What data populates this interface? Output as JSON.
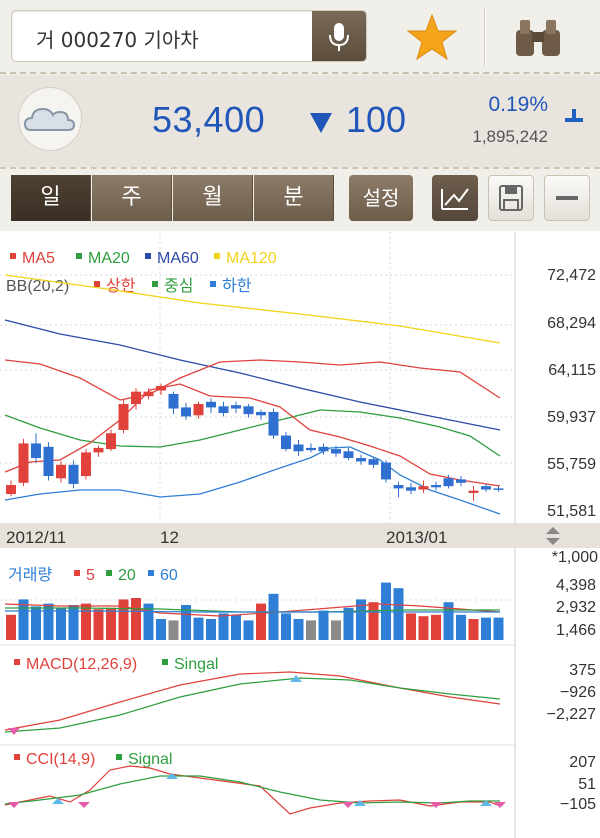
{
  "search": {
    "text": "거 000270 기아차"
  },
  "quote": {
    "price": "53,400",
    "change": "100",
    "change_pct": "0.19%",
    "volume": "1,895,242"
  },
  "periods": [
    {
      "label": "일",
      "active": true
    },
    {
      "label": "주"
    },
    {
      "label": "월"
    },
    {
      "label": "분"
    }
  ],
  "settings_label": "설정",
  "legend": {
    "ma": [
      {
        "label": "MA5",
        "color": "#e0413b"
      },
      {
        "label": "MA20",
        "color": "#2e9e3e"
      },
      {
        "label": "MA60",
        "color": "#2d4aa8"
      },
      {
        "label": "MA120",
        "color": "#f2d21b"
      }
    ],
    "bb_label": "BB(20,2)",
    "bb": [
      {
        "label": "상한",
        "color": "#e0413b"
      },
      {
        "label": "중심",
        "color": "#2e9e3e"
      },
      {
        "label": "하한",
        "color": "#2f7fd6"
      }
    ],
    "volume_title": "거래량",
    "volume_ma": [
      {
        "label": "5",
        "color": "#e0413b"
      },
      {
        "label": "20",
        "color": "#2e9e3e"
      },
      {
        "label": "60",
        "color": "#2f7fd6"
      }
    ],
    "macd_label": "MACD(12,26,9)",
    "macd_signal": "Singal",
    "cci_label": "CCI(14,9)",
    "cci_signal": "Signal"
  },
  "axis": {
    "price_ticks": [
      "72,472",
      "68,294",
      "64,115",
      "59,937",
      "55,759",
      "51,581"
    ],
    "volume_unit": "*1,000",
    "volume_ticks": [
      "4,398",
      "2,932",
      "1,466"
    ],
    "macd_ticks": [
      "375",
      "−926",
      "−2,227"
    ],
    "cci_ticks": [
      "207",
      "51",
      "−105"
    ],
    "dates": [
      "2012/11",
      "12",
      "2013/01"
    ]
  },
  "chart_data": {
    "type": "candlestick",
    "candles": [
      {
        "o": 53000,
        "c": 53800,
        "h": 54200,
        "l": 52800
      },
      {
        "o": 54000,
        "c": 57500,
        "h": 57900,
        "l": 53700
      },
      {
        "o": 57500,
        "c": 56200,
        "h": 58400,
        "l": 55800
      },
      {
        "o": 57200,
        "c": 54600,
        "h": 57600,
        "l": 54200
      },
      {
        "o": 54400,
        "c": 55600,
        "h": 55900,
        "l": 54000
      },
      {
        "o": 55600,
        "c": 53900,
        "h": 56000,
        "l": 53500
      },
      {
        "o": 54600,
        "c": 56700,
        "h": 57000,
        "l": 54300
      },
      {
        "o": 56700,
        "c": 57100,
        "h": 57300,
        "l": 56300
      },
      {
        "o": 57000,
        "c": 58400,
        "h": 58700,
        "l": 56800
      },
      {
        "o": 58700,
        "c": 61000,
        "h": 61400,
        "l": 58400
      },
      {
        "o": 61000,
        "c": 62100,
        "h": 62400,
        "l": 60500
      },
      {
        "o": 61700,
        "c": 62100,
        "h": 62400,
        "l": 61400
      },
      {
        "o": 62200,
        "c": 62600,
        "h": 62800,
        "l": 61800
      },
      {
        "o": 61900,
        "c": 60600,
        "h": 62100,
        "l": 60100
      },
      {
        "o": 60700,
        "c": 59900,
        "h": 61100,
        "l": 59600
      },
      {
        "o": 60000,
        "c": 61000,
        "h": 61200,
        "l": 59700
      },
      {
        "o": 61200,
        "c": 60700,
        "h": 61500,
        "l": 60200
      },
      {
        "o": 60800,
        "c": 60200,
        "h": 61200,
        "l": 59900
      },
      {
        "o": 60900,
        "c": 60600,
        "h": 61200,
        "l": 60200
      },
      {
        "o": 60800,
        "c": 60100,
        "h": 61000,
        "l": 59800
      },
      {
        "o": 60300,
        "c": 60000,
        "h": 60500,
        "l": 59600
      },
      {
        "o": 60300,
        "c": 58200,
        "h": 60600,
        "l": 57900
      },
      {
        "o": 58200,
        "c": 57000,
        "h": 58500,
        "l": 56800
      },
      {
        "o": 57400,
        "c": 56800,
        "h": 57800,
        "l": 56400
      },
      {
        "o": 57100,
        "c": 56900,
        "h": 57500,
        "l": 56700
      },
      {
        "o": 57200,
        "c": 56800,
        "h": 57500,
        "l": 56500
      },
      {
        "o": 57000,
        "c": 56600,
        "h": 57300,
        "l": 56300
      },
      {
        "o": 56800,
        "c": 56200,
        "h": 57100,
        "l": 56000
      },
      {
        "o": 56200,
        "c": 55900,
        "h": 56500,
        "l": 55600
      },
      {
        "o": 56100,
        "c": 55600,
        "h": 56300,
        "l": 55300
      },
      {
        "o": 55800,
        "c": 54300,
        "h": 56000,
        "l": 54000
      },
      {
        "o": 53800,
        "c": 53500,
        "h": 54100,
        "l": 52700
      },
      {
        "o": 53600,
        "c": 53300,
        "h": 54000,
        "l": 53000
      },
      {
        "o": 53400,
        "c": 53700,
        "h": 54200,
        "l": 53100
      },
      {
        "o": 53800,
        "c": 53600,
        "h": 54100,
        "l": 53300
      },
      {
        "o": 54400,
        "c": 53700,
        "h": 54700,
        "l": 53500
      },
      {
        "o": 54300,
        "c": 54000,
        "h": 54600,
        "l": 53700
      },
      {
        "o": 53100,
        "c": 53300,
        "h": 53700,
        "l": 52400
      },
      {
        "o": 53700,
        "c": 53400,
        "h": 53900,
        "l": 53200
      },
      {
        "o": 53500,
        "c": 53400,
        "h": 53700,
        "l": 53200
      }
    ],
    "volume": [
      1.8,
      2.9,
      2.4,
      2.6,
      2.3,
      2.5,
      2.6,
      2.2,
      2.3,
      2.9,
      3.0,
      2.6,
      1.5,
      1.4,
      2.5,
      1.6,
      1.5,
      1.9,
      1.8,
      1.4,
      2.6,
      3.3,
      1.9,
      1.5,
      1.4,
      2.1,
      1.4,
      2.3,
      2.9,
      2.7,
      4.1,
      3.7,
      1.9,
      1.7,
      1.8,
      2.7,
      1.8,
      1.5,
      1.6,
      1.6
    ],
    "volume_color": [
      "r",
      "b",
      "b",
      "b",
      "b",
      "b",
      "r",
      "r",
      "r",
      "r",
      "r",
      "b",
      "b",
      "g",
      "b",
      "b",
      "b",
      "b",
      "b",
      "b",
      "r",
      "b",
      "b",
      "b",
      "g",
      "b",
      "g",
      "b",
      "b",
      "r",
      "b",
      "b",
      "r",
      "r",
      "r",
      "b",
      "b",
      "r",
      "b",
      "b"
    ],
    "ylim": [
      51581,
      72472
    ]
  }
}
